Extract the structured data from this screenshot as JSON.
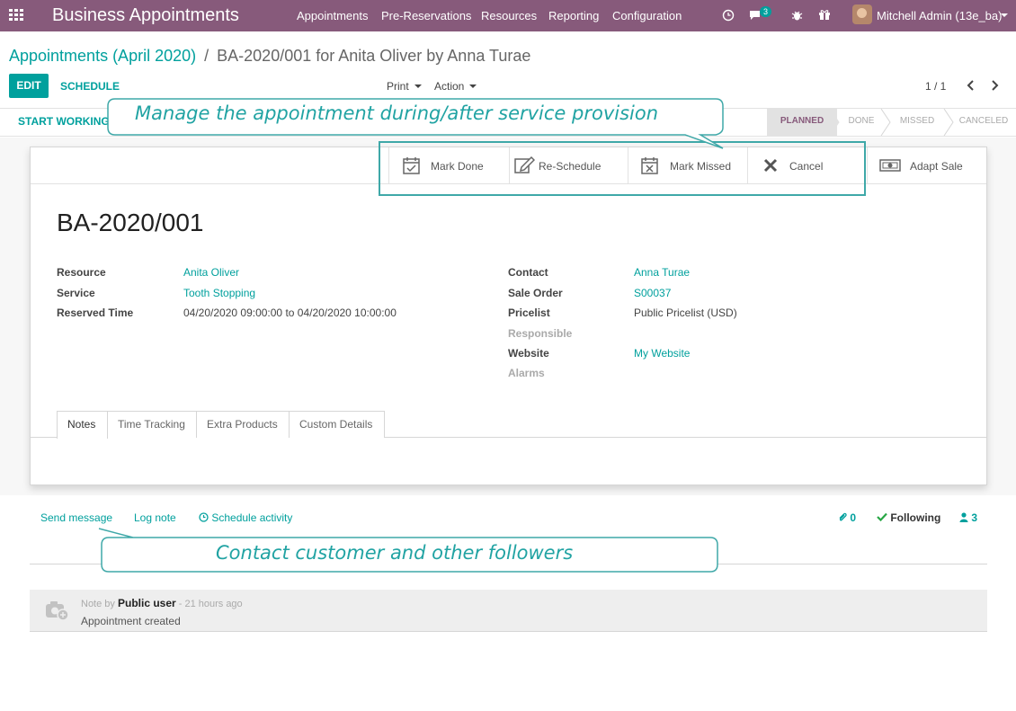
{
  "navbar": {
    "brand": "Business Appointments",
    "menu": [
      "Appointments",
      "Pre-Reservations",
      "Resources",
      "Reporting",
      "Configuration"
    ],
    "messages_count": "3",
    "user": "Mitchell Admin (13e_ba)"
  },
  "breadcrumb": {
    "parent": "Appointments (April 2020)",
    "separator": "/",
    "current": "BA-2020/001 for Anita Oliver by Anna Turae"
  },
  "controls": {
    "edit": "EDIT",
    "schedule": "SCHEDULE",
    "print": "Print",
    "action": "Action",
    "pager": "1 / 1"
  },
  "statusbar": {
    "start_working": "START WORKING",
    "stages": [
      "PLANNED",
      "DONE",
      "MISSED",
      "CANCELED"
    ],
    "active_stage": "PLANNED"
  },
  "button_box": {
    "mark_done": "Mark Done",
    "reschedule": "Re-Schedule",
    "mark_missed": "Mark Missed",
    "cancel": "Cancel",
    "adapt_sale": "Adapt Sale"
  },
  "record": {
    "title": "BA-2020/001",
    "left_fields": [
      {
        "label": "Resource",
        "value": "Anita Oliver"
      },
      {
        "label": "Service",
        "value": "Tooth Stopping"
      },
      {
        "label": "Reserved Time",
        "value": "04/20/2020 09:00:00 to 04/20/2020 10:00:00"
      }
    ],
    "right_fields": [
      {
        "label": "Contact",
        "value": "Anna Turae"
      },
      {
        "label": "Sale Order",
        "value": "S00037"
      },
      {
        "label": "Pricelist",
        "value": "Public Pricelist (USD)"
      },
      {
        "label": "Responsible",
        "value": ""
      },
      {
        "label": "Website",
        "value": "My Website"
      },
      {
        "label": "Alarms",
        "value": ""
      }
    ]
  },
  "tabs": [
    "Notes",
    "Time Tracking",
    "Extra Products",
    "Custom Details"
  ],
  "chatter": {
    "send_message": "Send message",
    "log_note": "Log note",
    "schedule_activity": "Schedule activity",
    "attachments": "0",
    "following": "Following",
    "followers": "3",
    "message": {
      "prefix": "Note by",
      "author": "Public user",
      "time": "- 21 hours ago",
      "body": "Appointment created"
    }
  },
  "callouts": {
    "top": "Manage the appointment during/after service provision",
    "bottom": "Contact customer and other followers"
  },
  "colors": {
    "brand": "#875a7b",
    "accent": "#00a09d",
    "callout": "#21a3a3"
  }
}
